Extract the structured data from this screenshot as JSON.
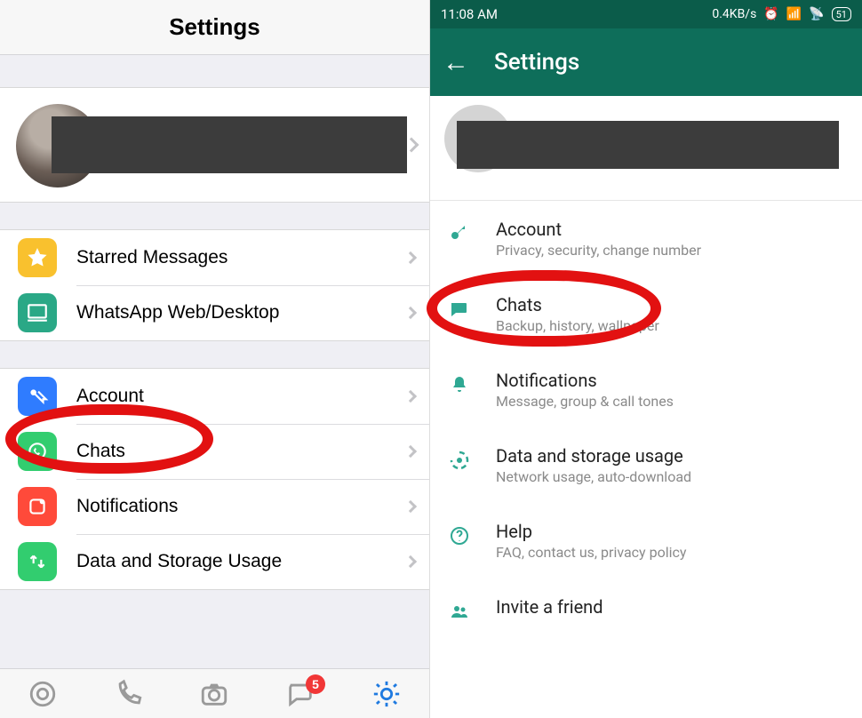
{
  "ios": {
    "header_title": "Settings",
    "group1": [
      {
        "key": "starred",
        "label": "Starred Messages"
      },
      {
        "key": "web",
        "label": "WhatsApp Web/Desktop"
      }
    ],
    "group2": [
      {
        "key": "account",
        "label": "Account"
      },
      {
        "key": "chats",
        "label": "Chats"
      },
      {
        "key": "notif",
        "label": "Notifications"
      },
      {
        "key": "data",
        "label": "Data and Storage Usage"
      }
    ],
    "chats_badge": "5"
  },
  "android": {
    "time": "11:08 AM",
    "net_speed": "0.4KB/s",
    "battery": "51",
    "toolbar_title": "Settings",
    "items": [
      {
        "key": "account",
        "title": "Account",
        "sub": "Privacy, security, change number"
      },
      {
        "key": "chats",
        "title": "Chats",
        "sub": "Backup, history, wallpaper"
      },
      {
        "key": "notif",
        "title": "Notifications",
        "sub": "Message, group & call tones"
      },
      {
        "key": "data",
        "title": "Data and storage usage",
        "sub": "Network usage, auto-download"
      },
      {
        "key": "help",
        "title": "Help",
        "sub": "FAQ, contact us, privacy policy"
      },
      {
        "key": "invite",
        "title": "Invite a friend",
        "sub": ""
      }
    ]
  },
  "colors": {
    "teal": "#0e6e5a",
    "highlight": "#e21111"
  }
}
